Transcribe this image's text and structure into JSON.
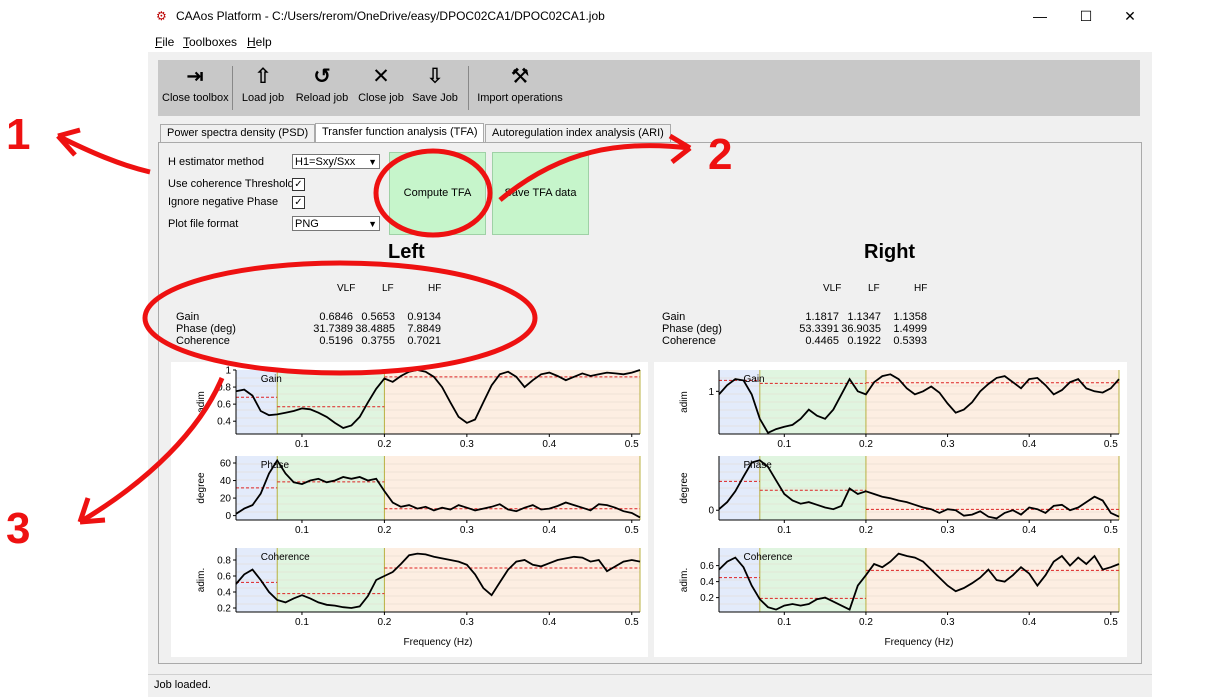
{
  "window": {
    "title": "CAAos Platform - C:/Users/rerom/OneDrive/easy/DPOC02CA1/DPOC02CA1.job",
    "icon": "app-logo-icon",
    "minimize": "—",
    "maximize": "☐",
    "close": "✕"
  },
  "menu": [
    {
      "label": "File",
      "key": "F",
      "rest": "ile"
    },
    {
      "label": "Toolboxes",
      "key": "T",
      "rest": "oolboxes"
    },
    {
      "label": "Help",
      "key": "H",
      "rest": "elp"
    }
  ],
  "toolbar": [
    {
      "label": "Close toolbox",
      "icon": "close-toolbox-icon",
      "glyph": "⇥"
    },
    {
      "label": "Load job",
      "icon": "upload-icon",
      "glyph": "⇧"
    },
    {
      "label": "Reload job",
      "icon": "reload-icon",
      "glyph": "↺"
    },
    {
      "label": "Close job",
      "icon": "close-icon",
      "glyph": "✕"
    },
    {
      "label": "Save Job",
      "icon": "download-icon",
      "glyph": "⇩"
    },
    {
      "label": "Import operations",
      "icon": "tools-icon",
      "glyph": "⚒"
    }
  ],
  "tabs": [
    {
      "label": "Power spectra density (PSD)",
      "active": false
    },
    {
      "label": "Transfer function analysis (TFA)",
      "active": true
    },
    {
      "label": "Autoregulation index analysis (ARI)",
      "active": false
    }
  ],
  "options": {
    "h_estimator_label": "H estimator method",
    "h_estimator_value": "H1=Sxy/Sxx",
    "coherence_threshold_label": "Use coherence Threshold",
    "coherence_threshold_checked": "✓",
    "ignore_negative_phase_label": "Ignore negative Phase",
    "ignore_negative_phase_checked": "✓",
    "plot_format_label": "Plot file format",
    "plot_format_value": "PNG"
  },
  "buttons": {
    "compute": "Compute TFA",
    "save": "Save TFA data"
  },
  "colors": {
    "button_green": "#c6f5cb",
    "vlf_band": "#e3ebfb",
    "lf_band": "#e0f5e0",
    "hf_band": "#fdeee2",
    "mean_line": "#dd2222",
    "annotation": "#ee1111"
  },
  "results": {
    "columns": [
      "VLF",
      "LF",
      "HF"
    ],
    "left": {
      "title": "Left",
      "rows": [
        {
          "label": "Gain",
          "values": [
            "0.6846",
            "0.5653",
            "0.9134"
          ]
        },
        {
          "label": "Phase (deg)",
          "values": [
            "31.7389",
            "38.4885",
            "7.8849"
          ]
        },
        {
          "label": "Coherence",
          "values": [
            "0.5196",
            "0.3755",
            "0.7021"
          ]
        }
      ]
    },
    "right": {
      "title": "Right",
      "rows": [
        {
          "label": "Gain",
          "values": [
            "1.1817",
            "1.1347",
            "1.1358"
          ]
        },
        {
          "label": "Phase (deg)",
          "values": [
            "53.3391",
            "36.9035",
            "1.4999"
          ]
        },
        {
          "label": "Coherence",
          "values": [
            "0.4465",
            "0.1922",
            "0.5393"
          ]
        }
      ]
    }
  },
  "plots": {
    "xlabel": "Frequency (Hz)",
    "xticks": [
      "0.1",
      "0.2",
      "0.3",
      "0.4",
      "0.5"
    ],
    "xtick_values": [
      0.1,
      0.2,
      0.3,
      0.4,
      0.5
    ],
    "xlim": [
      0.02,
      0.51
    ],
    "band_edges": [
      0.02,
      0.07,
      0.2,
      0.51
    ],
    "left": [
      {
        "label": "Gain",
        "ylabel": "adim",
        "ylim": [
          0.25,
          1.0
        ],
        "yticks": [
          {
            "v": 1.0,
            "t": "1"
          },
          {
            "v": 0.8,
            "t": "0.8"
          },
          {
            "v": 0.6,
            "t": "0.6"
          },
          {
            "v": 0.4,
            "t": "0.4"
          }
        ],
        "means": [
          0.68,
          0.57,
          0.92
        ],
        "x": [
          0.02,
          0.03,
          0.04,
          0.05,
          0.06,
          0.07,
          0.08,
          0.09,
          0.1,
          0.11,
          0.12,
          0.13,
          0.14,
          0.15,
          0.16,
          0.17,
          0.18,
          0.19,
          0.2,
          0.21,
          0.22,
          0.23,
          0.24,
          0.25,
          0.26,
          0.27,
          0.28,
          0.29,
          0.3,
          0.31,
          0.32,
          0.33,
          0.34,
          0.35,
          0.36,
          0.37,
          0.38,
          0.39,
          0.4,
          0.41,
          0.42,
          0.43,
          0.44,
          0.45,
          0.46,
          0.47,
          0.48,
          0.49,
          0.5,
          0.51
        ],
        "y": [
          0.75,
          0.77,
          0.7,
          0.52,
          0.47,
          0.48,
          0.5,
          0.52,
          0.55,
          0.54,
          0.5,
          0.45,
          0.38,
          0.32,
          0.35,
          0.45,
          0.62,
          0.78,
          0.9,
          0.86,
          0.93,
          0.98,
          1.0,
          0.98,
          0.92,
          0.8,
          0.62,
          0.45,
          0.38,
          0.42,
          0.62,
          0.82,
          0.95,
          0.98,
          0.92,
          0.8,
          0.88,
          0.95,
          0.97,
          0.93,
          0.88,
          0.92,
          0.96,
          0.93,
          0.95,
          0.97,
          0.96,
          0.95,
          0.97,
          1.0
        ]
      },
      {
        "label": "Phase",
        "ylabel": "degree",
        "ylim": [
          -5,
          68
        ],
        "yticks": [
          {
            "v": 60,
            "t": "60"
          },
          {
            "v": 40,
            "t": "40"
          },
          {
            "v": 20,
            "t": "20"
          },
          {
            "v": 0,
            "t": "0"
          }
        ],
        "means": [
          31.7,
          38.5,
          7.9
        ],
        "x": [
          0.02,
          0.03,
          0.04,
          0.05,
          0.06,
          0.07,
          0.08,
          0.09,
          0.1,
          0.11,
          0.12,
          0.13,
          0.14,
          0.15,
          0.16,
          0.17,
          0.18,
          0.19,
          0.2,
          0.21,
          0.22,
          0.23,
          0.24,
          0.25,
          0.26,
          0.27,
          0.28,
          0.29,
          0.3,
          0.31,
          0.32,
          0.33,
          0.34,
          0.35,
          0.36,
          0.37,
          0.38,
          0.39,
          0.4,
          0.41,
          0.42,
          0.43,
          0.44,
          0.45,
          0.46,
          0.47,
          0.48,
          0.49,
          0.5,
          0.51
        ],
        "y": [
          2,
          8,
          12,
          25,
          48,
          63,
          48,
          38,
          36,
          40,
          42,
          38,
          40,
          44,
          42,
          44,
          40,
          42,
          28,
          15,
          10,
          12,
          8,
          10,
          6,
          9,
          7,
          12,
          9,
          6,
          8,
          10,
          13,
          7,
          5,
          9,
          12,
          7,
          8,
          11,
          15,
          12,
          9,
          6,
          13,
          12,
          9,
          5,
          3,
          -2
        ]
      },
      {
        "label": "Coherence",
        "ylabel": "adim.",
        "ylim": [
          0.15,
          0.95
        ],
        "yticks": [
          {
            "v": 0.8,
            "t": "0.8"
          },
          {
            "v": 0.6,
            "t": "0.6"
          },
          {
            "v": 0.4,
            "t": "0.4"
          },
          {
            "v": 0.2,
            "t": "0.2"
          }
        ],
        "means": [
          0.52,
          0.38,
          0.7
        ],
        "x": [
          0.02,
          0.03,
          0.04,
          0.05,
          0.06,
          0.07,
          0.08,
          0.09,
          0.1,
          0.11,
          0.12,
          0.13,
          0.14,
          0.15,
          0.16,
          0.17,
          0.18,
          0.19,
          0.2,
          0.21,
          0.22,
          0.23,
          0.24,
          0.25,
          0.26,
          0.27,
          0.28,
          0.29,
          0.3,
          0.31,
          0.32,
          0.33,
          0.34,
          0.35,
          0.36,
          0.37,
          0.38,
          0.39,
          0.4,
          0.41,
          0.42,
          0.43,
          0.44,
          0.45,
          0.46,
          0.47,
          0.48,
          0.49,
          0.5,
          0.51
        ],
        "y": [
          0.5,
          0.62,
          0.68,
          0.55,
          0.4,
          0.3,
          0.27,
          0.32,
          0.36,
          0.32,
          0.27,
          0.24,
          0.23,
          0.21,
          0.2,
          0.22,
          0.35,
          0.55,
          0.6,
          0.65,
          0.75,
          0.86,
          0.88,
          0.87,
          0.84,
          0.82,
          0.8,
          0.78,
          0.74,
          0.62,
          0.45,
          0.36,
          0.52,
          0.68,
          0.78,
          0.8,
          0.74,
          0.72,
          0.76,
          0.8,
          0.82,
          0.84,
          0.83,
          0.78,
          0.8,
          0.66,
          0.72,
          0.78,
          0.8,
          0.78
        ]
      }
    ],
    "right": [
      {
        "label": "Gain",
        "ylabel": "adim",
        "ylim": [
          0.3,
          1.35
        ],
        "yticks": [
          {
            "v": 1.0,
            "t": "1"
          }
        ],
        "means": [
          1.18,
          1.13,
          1.14
        ],
        "x": [
          0.02,
          0.03,
          0.04,
          0.05,
          0.06,
          0.07,
          0.08,
          0.09,
          0.1,
          0.11,
          0.12,
          0.13,
          0.14,
          0.15,
          0.16,
          0.17,
          0.18,
          0.19,
          0.2,
          0.21,
          0.22,
          0.23,
          0.24,
          0.25,
          0.26,
          0.27,
          0.28,
          0.29,
          0.3,
          0.31,
          0.32,
          0.33,
          0.34,
          0.35,
          0.36,
          0.37,
          0.38,
          0.39,
          0.4,
          0.41,
          0.42,
          0.43,
          0.44,
          0.45,
          0.46,
          0.47,
          0.48,
          0.49,
          0.5,
          0.51
        ],
        "y": [
          0.95,
          1.1,
          1.2,
          1.18,
          0.95,
          0.55,
          0.32,
          0.38,
          0.42,
          0.45,
          0.55,
          0.7,
          0.6,
          0.55,
          0.7,
          0.95,
          1.2,
          1.0,
          0.95,
          1.15,
          1.25,
          1.28,
          1.2,
          1.05,
          0.95,
          1.0,
          1.08,
          0.98,
          0.8,
          0.65,
          0.7,
          0.82,
          1.0,
          1.12,
          1.22,
          1.25,
          1.15,
          1.05,
          1.2,
          1.22,
          1.1,
          0.95,
          1.02,
          1.15,
          1.2,
          1.05,
          1.0,
          0.98,
          1.05,
          1.2
        ]
      },
      {
        "label": "Phase",
        "ylabel": "degree",
        "ylim": [
          -18,
          100
        ],
        "yticks": [
          {
            "v": 0,
            "t": "0"
          }
        ],
        "means": [
          53.3,
          36.9,
          1.5
        ],
        "x": [
          0.02,
          0.03,
          0.04,
          0.05,
          0.06,
          0.07,
          0.08,
          0.09,
          0.1,
          0.11,
          0.12,
          0.13,
          0.14,
          0.15,
          0.16,
          0.17,
          0.18,
          0.19,
          0.2,
          0.21,
          0.22,
          0.23,
          0.24,
          0.25,
          0.26,
          0.27,
          0.28,
          0.29,
          0.3,
          0.31,
          0.32,
          0.33,
          0.34,
          0.35,
          0.36,
          0.37,
          0.38,
          0.39,
          0.4,
          0.41,
          0.42,
          0.43,
          0.44,
          0.45,
          0.46,
          0.47,
          0.48,
          0.49,
          0.5,
          0.51
        ],
        "y": [
          2,
          15,
          35,
          62,
          88,
          92,
          80,
          55,
          30,
          18,
          12,
          15,
          10,
          5,
          2,
          8,
          40,
          30,
          35,
          30,
          25,
          22,
          18,
          15,
          10,
          5,
          2,
          -5,
          2,
          0,
          -10,
          -8,
          -2,
          -12,
          -15,
          -5,
          0,
          -8,
          5,
          2,
          -5,
          8,
          10,
          0,
          5,
          15,
          25,
          18,
          -5,
          -12
        ]
      },
      {
        "label": "Coherence",
        "ylabel": "adim.",
        "ylim": [
          0.02,
          0.82
        ],
        "yticks": [
          {
            "v": 0.6,
            "t": "0.6"
          },
          {
            "v": 0.4,
            "t": "0.4"
          },
          {
            "v": 0.2,
            "t": "0.2"
          }
        ],
        "means": [
          0.45,
          0.19,
          0.54
        ],
        "x": [
          0.02,
          0.03,
          0.04,
          0.05,
          0.06,
          0.07,
          0.08,
          0.09,
          0.1,
          0.11,
          0.12,
          0.13,
          0.14,
          0.15,
          0.16,
          0.17,
          0.18,
          0.19,
          0.2,
          0.21,
          0.22,
          0.23,
          0.24,
          0.25,
          0.26,
          0.27,
          0.28,
          0.29,
          0.3,
          0.31,
          0.32,
          0.33,
          0.34,
          0.35,
          0.36,
          0.37,
          0.38,
          0.39,
          0.4,
          0.41,
          0.42,
          0.43,
          0.44,
          0.45,
          0.46,
          0.47,
          0.48,
          0.49,
          0.5,
          0.51
        ],
        "y": [
          0.55,
          0.65,
          0.7,
          0.58,
          0.35,
          0.18,
          0.08,
          0.05,
          0.1,
          0.12,
          0.1,
          0.12,
          0.18,
          0.2,
          0.15,
          0.1,
          0.05,
          0.35,
          0.48,
          0.62,
          0.58,
          0.65,
          0.75,
          0.72,
          0.7,
          0.65,
          0.55,
          0.45,
          0.35,
          0.28,
          0.32,
          0.38,
          0.45,
          0.55,
          0.42,
          0.4,
          0.48,
          0.58,
          0.5,
          0.35,
          0.48,
          0.65,
          0.72,
          0.6,
          0.7,
          0.62,
          0.72,
          0.55,
          0.58,
          0.62
        ]
      }
    ]
  },
  "status": "Job loaded.",
  "annotations": [
    "1",
    "2",
    "3"
  ]
}
